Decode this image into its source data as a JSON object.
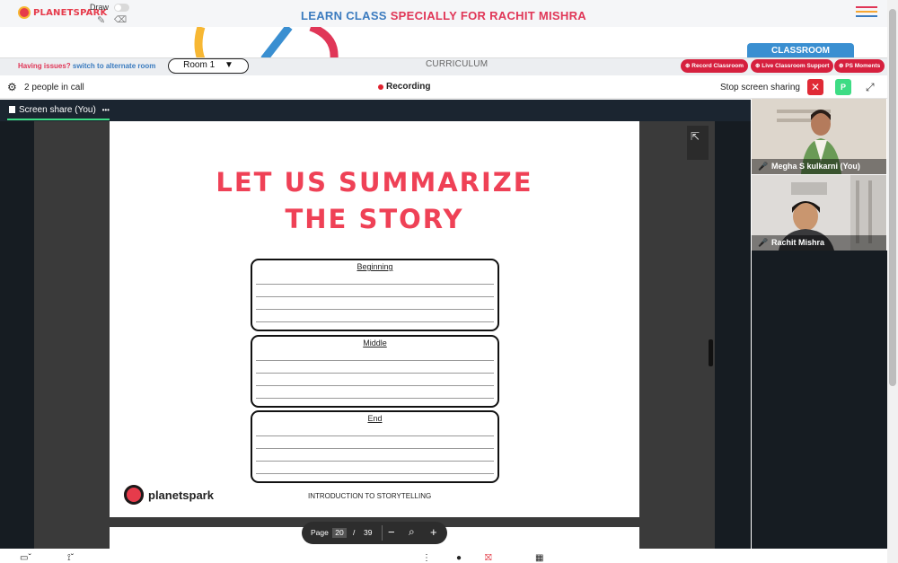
{
  "header": {
    "brand": "PLANETSPARK",
    "draw_label": "Draw",
    "title_part1": "LEARN CLASS ",
    "title_part2": "SPECIALLY FOR RACHIT MISHRA",
    "classroom_tab": "CLASSROOM",
    "icons": [
      "pencil-icon",
      "eraser-icon",
      "hamburger-menu-icon"
    ]
  },
  "issues_bar": {
    "issues_text": "Having issues?",
    "switch_link": "switch to alternate room",
    "room": "Room 1",
    "curriculum": "CURRICULUM",
    "pills": [
      "Record Classroom",
      "Live Classroom Support",
      "PS Moments"
    ]
  },
  "call_bar": {
    "people": "2 people in call",
    "recording": "Recording",
    "stop_sharing": "Stop screen sharing",
    "p_button": "P"
  },
  "stage": {
    "share_label": "Screen share (You)",
    "more": "•••"
  },
  "slide": {
    "heading_line1": "LET US SUMMARIZE",
    "heading_line2": "THE STORY",
    "sections": [
      "Beginning",
      "Middle",
      "End"
    ],
    "logo": "planetspark",
    "footer": "INTRODUCTION TO STORYTELLING"
  },
  "pager": {
    "page_word": "Page",
    "current": "20",
    "slash": "/",
    "total": "39"
  },
  "participants": [
    {
      "name": "Megha S kulkarni (You)"
    },
    {
      "name": "Rachit Mishra"
    }
  ],
  "colors": {
    "accent_red": "#e03657",
    "accent_blue": "#3b7bbf",
    "classroom_blue": "#3a8fd1",
    "green": "#3ddc84"
  }
}
